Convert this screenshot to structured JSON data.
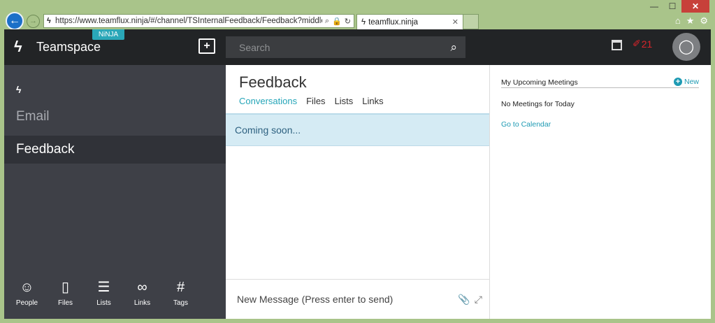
{
  "browser": {
    "url": "https://www.teamflux.ninja/#/channel/TSInternalFeedback/Feedback?middlePane=cc",
    "tab_title": "teamflux.ninja",
    "close_symbol": "✕",
    "window_controls": [
      "—",
      "☐",
      "✕"
    ]
  },
  "header": {
    "brand": "Teamspace",
    "badge": "NiNJA",
    "search_placeholder": "Search",
    "alert_count": "21"
  },
  "sidebar": {
    "items": [
      {
        "label": "Email"
      },
      {
        "label": "Feedback"
      }
    ],
    "tools": [
      {
        "label": "People",
        "icon": "person-icon"
      },
      {
        "label": "Files",
        "icon": "file-icon"
      },
      {
        "label": "Lists",
        "icon": "list-icon"
      },
      {
        "label": "Links",
        "icon": "link-icon"
      },
      {
        "label": "Tags",
        "icon": "hash-icon"
      }
    ]
  },
  "channel": {
    "title": "Feedback",
    "tabs": [
      "Conversations",
      "Files",
      "Lists",
      "Links"
    ],
    "active_tab": "Conversations",
    "status_message": "Coming soon...",
    "composer_placeholder": "New Message (Press enter to send)"
  },
  "meetings": {
    "heading": "My Upcoming Meetings",
    "new_label": "New",
    "empty_text": "No Meetings for Today",
    "calendar_link": "Go to Calendar"
  },
  "colors": {
    "accent": "#25a5b8",
    "topbar": "#222426",
    "sidebar": "#3e4047",
    "alert": "#d8242b"
  }
}
